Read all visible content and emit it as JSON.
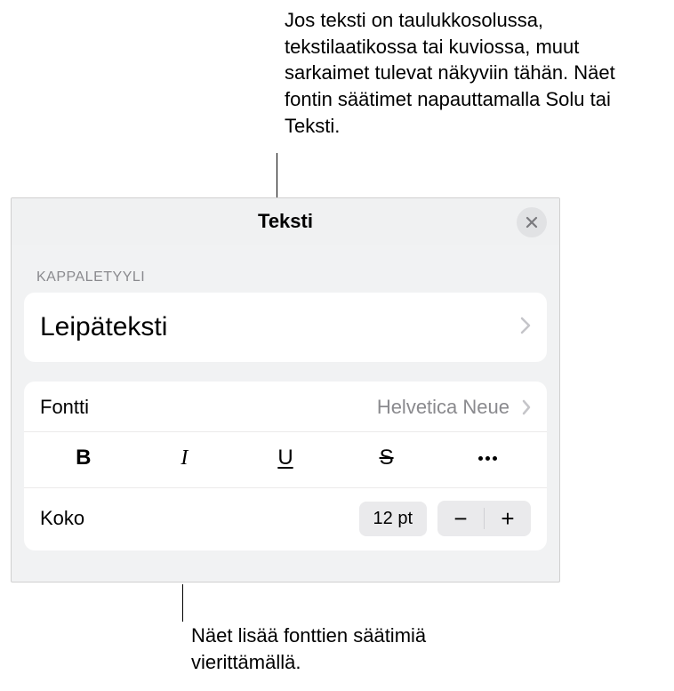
{
  "annotations": {
    "top": "Jos teksti on taulukkosolussa, tekstilaatikossa tai kuviossa, muut sarkaimet tulevat näkyviin tähän. Näet fontin säätimet napauttamalla Solu tai Teksti.",
    "bottom": "Näet lisää fonttien säätimiä vierittämällä."
  },
  "panel": {
    "title": "Teksti",
    "sectionLabel": "KAPPALETYYLI",
    "paragraphStyle": "Leipäteksti",
    "font": {
      "label": "Fontti",
      "value": "Helvetica Neue"
    },
    "format": {
      "bold": "B",
      "italic": "I",
      "underline": "U",
      "strike": "S"
    },
    "size": {
      "label": "Koko",
      "value": "12 pt",
      "minus": "−",
      "plus": "+"
    }
  }
}
